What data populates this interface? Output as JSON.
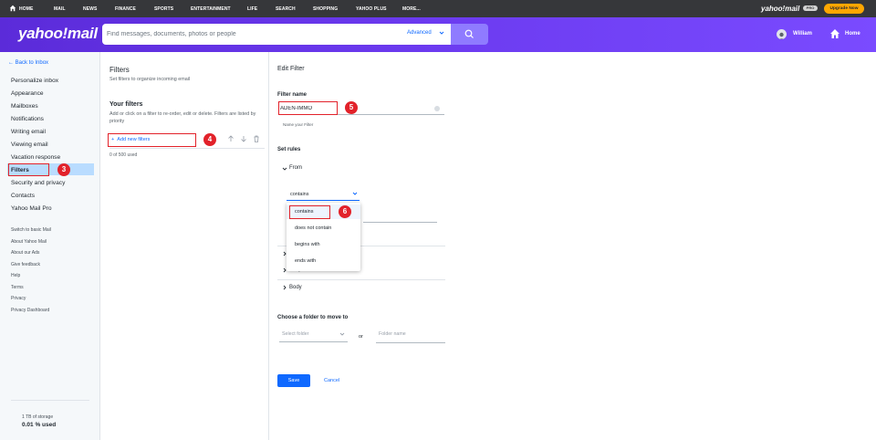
{
  "topnav": {
    "items": [
      "HOME",
      "MAIL",
      "NEWS",
      "FINANCE",
      "SPORTS",
      "ENTERTAINMENT",
      "LIFE",
      "SEARCH",
      "SHOPPING",
      "YAHOO PLUS",
      "MORE..."
    ],
    "logo": "yahoo!mail",
    "logo_badge": "PRO",
    "upgrade": "Upgrade Now"
  },
  "header": {
    "brand": "yahoo!mail",
    "search_placeholder": "Find messages, documents, photos or people",
    "advanced": "Advanced",
    "user_name": "William",
    "home": "Home"
  },
  "sidebar": {
    "back": "Back to Inbox",
    "items": [
      "Personalize inbox",
      "Appearance",
      "Mailboxes",
      "Notifications",
      "Writing email",
      "Viewing email",
      "Vacation response",
      "Filters",
      "Security and privacy",
      "Contacts",
      "Yahoo Mail Pro"
    ],
    "links": [
      "Switch to basic Mail",
      "About Yahoo Mail",
      "About our Ads",
      "Give feedback",
      "Help",
      "Terms",
      "Privacy",
      "Privacy Dashboard"
    ],
    "storage_total": "1 TB of storage",
    "storage_used": "0.01 % used"
  },
  "filters": {
    "title": "Filters",
    "subtitle": "Set filters to organize incoming email",
    "your_filters": "Your filters",
    "description": "Add or click on a filter to re-order, edit or delete. Filters are listed by priority",
    "add_new": "Add new filters",
    "count": "0 of 500 used"
  },
  "edit": {
    "title": "Edit Filter",
    "filter_name_label": "Filter name",
    "filter_name_value": "ADEN-IMMO",
    "name_hint": "Name your Filter",
    "set_rules": "Set rules",
    "rule_from": "From",
    "condition_selected": "contains",
    "rule_subject": "Subject",
    "rule_body": "Body",
    "dropdown_options": [
      "contains",
      "does not contain",
      "begins with",
      "ends with"
    ],
    "choose_folder": "Choose a folder to move to",
    "select_folder": "Select folder",
    "or": "or",
    "folder_name_placeholder": "Folder name",
    "save": "Save",
    "cancel": "Cancel"
  },
  "markers": [
    "3",
    "4",
    "5",
    "6"
  ],
  "colors": {
    "accent": "#0f69ff",
    "brand": "#6c3bf0",
    "marker": "#e2222a",
    "upgrade": "#ffa700"
  }
}
